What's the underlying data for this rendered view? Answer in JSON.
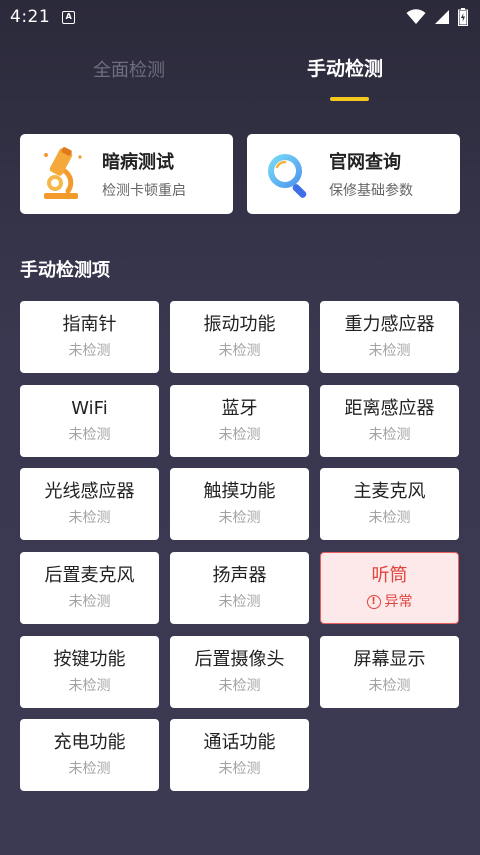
{
  "status_bar": {
    "time": "4:21",
    "badge": "A"
  },
  "tabs": {
    "all_label": "全面检测",
    "manual_label": "手动检测",
    "active": "manual",
    "indicator_color": "#f4c81c"
  },
  "cards": {
    "hidden": {
      "title": "暗病测试",
      "subtitle": "检测卡顿重启",
      "icon": "microscope-icon"
    },
    "official": {
      "title": "官网查询",
      "subtitle": "保修基础参数",
      "icon": "magnifier-icon"
    }
  },
  "section_title": "手动检测项",
  "items": [
    {
      "name": "指南针",
      "status": "未检测"
    },
    {
      "name": "振动功能",
      "status": "未检测"
    },
    {
      "name": "重力感应器",
      "status": "未检测"
    },
    {
      "name": "WiFi",
      "status": "未检测"
    },
    {
      "name": "蓝牙",
      "status": "未检测"
    },
    {
      "name": "距离感应器",
      "status": "未检测"
    },
    {
      "name": "光线感应器",
      "status": "未检测"
    },
    {
      "name": "触摸功能",
      "status": "未检测"
    },
    {
      "name": "主麦克风",
      "status": "未检测"
    },
    {
      "name": "后置麦克风",
      "status": "未检测"
    },
    {
      "name": "扬声器",
      "status": "未检测"
    },
    {
      "name": "听筒",
      "status": "异常",
      "error": true
    },
    {
      "name": "按键功能",
      "status": "未检测"
    },
    {
      "name": "后置摄像头",
      "status": "未检测"
    },
    {
      "name": "屏幕显示",
      "status": "未检测"
    },
    {
      "name": "充电功能",
      "status": "未检测"
    },
    {
      "name": "通话功能",
      "status": "未检测"
    }
  ],
  "colors": {
    "error": "#e2433f",
    "accent": "#f4c81c"
  }
}
